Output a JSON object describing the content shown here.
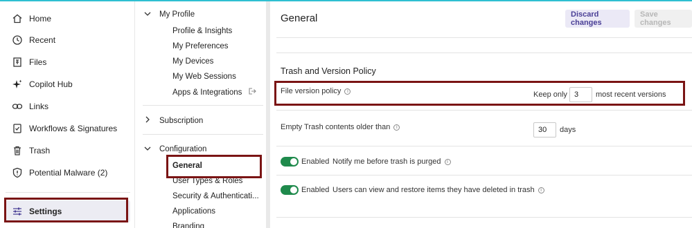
{
  "nav": {
    "items": [
      {
        "label": "Home",
        "icon": "home-icon"
      },
      {
        "label": "Recent",
        "icon": "clock-icon"
      },
      {
        "label": "Files",
        "icon": "files-icon"
      },
      {
        "label": "Copilot Hub",
        "icon": "sparkle-icon"
      },
      {
        "label": "Links",
        "icon": "link-icon"
      },
      {
        "label": "Workflows & Signatures",
        "icon": "workflow-icon"
      },
      {
        "label": "Trash",
        "icon": "trash-icon"
      },
      {
        "label": "Potential Malware (2)",
        "icon": "shield-icon"
      }
    ],
    "settings": {
      "label": "Settings",
      "icon": "sliders-icon"
    }
  },
  "tree": {
    "my_profile": {
      "label": "My Profile",
      "children": [
        "Profile & Insights",
        "My Preferences",
        "My Devices",
        "My Web Sessions",
        "Apps & Integrations"
      ]
    },
    "subscription": {
      "label": "Subscription"
    },
    "configuration": {
      "label": "Configuration",
      "children": [
        "General",
        "User Types & Roles",
        "Security & Authenticati...",
        "Applications",
        "Branding"
      ]
    }
  },
  "main": {
    "title": "General",
    "discard_label": "Discard changes",
    "save_label": "Save changes",
    "section_title": "Trash and Version Policy",
    "version_policy": {
      "label": "File version policy",
      "prefix": "Keep only",
      "value": "3",
      "suffix": "most recent versions"
    },
    "empty_trash": {
      "label": "Empty Trash contents older than",
      "value": "30",
      "suffix": "days"
    },
    "notify_toggle": {
      "state": "Enabled",
      "label": "Notify me before trash is purged"
    },
    "restore_toggle": {
      "state": "Enabled",
      "label": "Users can view and restore items they have deleted in trash"
    }
  },
  "colors": {
    "accent": "#4a3f96",
    "toggle_on": "#1f8a4c",
    "highlight": "#7a1414",
    "top_bar": "#2fbfd1"
  }
}
